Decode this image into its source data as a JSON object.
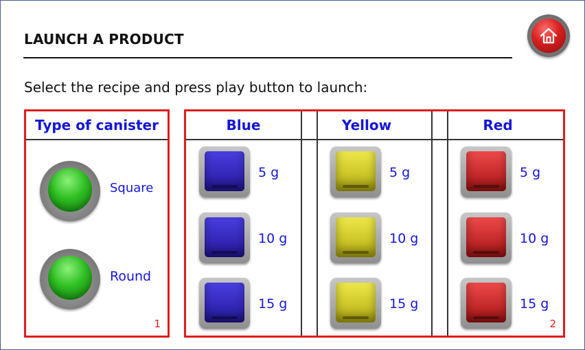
{
  "page": {
    "title": "LAUNCH A PRODUCT",
    "instruction": "Select the recipe and press play button to launch:"
  },
  "home_button": {
    "icon": "home-icon",
    "color": "#d62020"
  },
  "canister_panel": {
    "header": "Type of canister",
    "number": "1",
    "options": [
      {
        "label": "Square",
        "color": "#2fbf22"
      },
      {
        "label": "Round",
        "color": "#2fbf22"
      }
    ]
  },
  "recipe_panel": {
    "number": "2",
    "columns": [
      {
        "header": "Blue",
        "color": "#2a20c8",
        "weights": [
          "5 g",
          "10 g",
          "15 g"
        ]
      },
      {
        "header": "Yellow",
        "color": "#d6cf1c",
        "weights": [
          "5 g",
          "10 g",
          "15 g"
        ]
      },
      {
        "header": "Red",
        "color": "#cf2020",
        "weights": [
          "5 g",
          "10 g",
          "15 g"
        ]
      }
    ]
  },
  "colors": {
    "panel_border": "#e11b1b",
    "label_text": "#1515d8"
  }
}
